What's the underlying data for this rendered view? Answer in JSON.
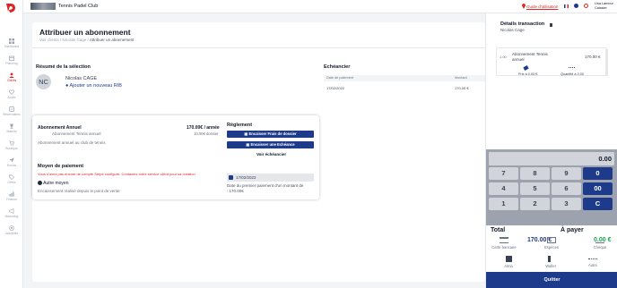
{
  "sidebar": {
    "items": [
      {
        "label": "Dashboard",
        "icon": "grid-icon"
      },
      {
        "label": "Planning",
        "icon": "calendar-icon"
      },
      {
        "label": "Clients",
        "icon": "users-icon"
      },
      {
        "label": "Accès",
        "icon": "heart-icon"
      },
      {
        "label": "Réservations",
        "icon": "booking-icon"
      },
      {
        "label": "Matchs",
        "icon": "trophy-icon"
      },
      {
        "label": "Boutique",
        "icon": "cart-icon"
      },
      {
        "label": "Envois",
        "icon": "send-icon"
      },
      {
        "label": "Offres",
        "icon": "tag-icon"
      },
      {
        "label": "Finance",
        "icon": "finance-icon"
      },
      {
        "label": "Marketing",
        "icon": "megaphone-icon"
      },
      {
        "label": "Actualités",
        "icon": "news-icon"
      }
    ]
  },
  "topbar": {
    "club_name": "Tennis Padel Club",
    "guide": "Guide d'utilisation",
    "user_name": "Lisa Lamour",
    "user_role": "Caissier"
  },
  "page": {
    "title": "Attribuer un abonnement",
    "crumb_1": "Voir clients",
    "crumb_sep": " / ",
    "crumb_2": "Nicolas Cage",
    "crumb_3": "Attribuer un abonnement"
  },
  "summary": {
    "title": "Résumé de la sélection",
    "initials": "NC",
    "client_name": "Nicolas CAGE",
    "add_rib": "Ajouter un nouveau RIB"
  },
  "subscription": {
    "title": "Abonnement Annuel",
    "subtitle": "Abonnement Tennis annuel",
    "description": "Abonnement annuel au club de tennis",
    "price": "170.00€ / année",
    "fees": "10.00€ dossier"
  },
  "payment_method": {
    "title": "Moyen de paiement",
    "error": "Vous n'avez pas encore de compte Stripe configuré. Contactez notre service client pour sa création",
    "other_means": "Autre moyen",
    "collection_note": "Encaissement réalisé depuis le point de vente"
  },
  "settlement": {
    "title": "Règlement",
    "btn_fees": "Encaisser Frais de dossier",
    "btn_installment": "Encaisser une Echéance",
    "view_schedule": "Voir échéancier",
    "date_value": "17/02/2022",
    "first_payment_note_1": "Date du premier paiement d'un montant de",
    "first_payment_note_2": ": 170.00€"
  },
  "schedule": {
    "title": "Echéancier",
    "col_date": "Date de paiement",
    "col_amount": "Montant",
    "row_date": "17/02/2022",
    "row_amount": "170.00 €"
  },
  "transaction": {
    "title": "Détails transaction",
    "client": "Nicolas Cage",
    "qty": "1.00",
    "item_name_1": "Abonnement Tennis",
    "item_name_2": "annuel",
    "item_price": "170.00 €",
    "unit_price_label": "Prix à 0.00 €",
    "quantity_label": "Quantité à 0.00",
    "display": "0.00",
    "keys": [
      "7",
      "8",
      "9",
      "0",
      "4",
      "5",
      "6",
      "00",
      "1",
      "2",
      "3",
      "C"
    ],
    "total_label": "Total",
    "total_value": "170.00 €",
    "to_pay_label": "À payer",
    "to_pay_value": "0.00 €",
    "pay_methods": [
      {
        "label": "Carte bancaire",
        "icon": "card-icon"
      },
      {
        "label": "Espèces",
        "icon": "cash-icon"
      },
      {
        "label": "Chèque",
        "icon": "cheque-icon"
      },
      {
        "label": "Alma",
        "icon": "alma-icon"
      },
      {
        "label": "Wallet",
        "icon": "wallet-icon"
      },
      {
        "label": "Autre",
        "icon": "more-icon"
      }
    ],
    "quit": "Quitter"
  },
  "colors": {
    "brand": "#dc2626",
    "primary": "#1e3a8a",
    "success": "#16a34a"
  }
}
